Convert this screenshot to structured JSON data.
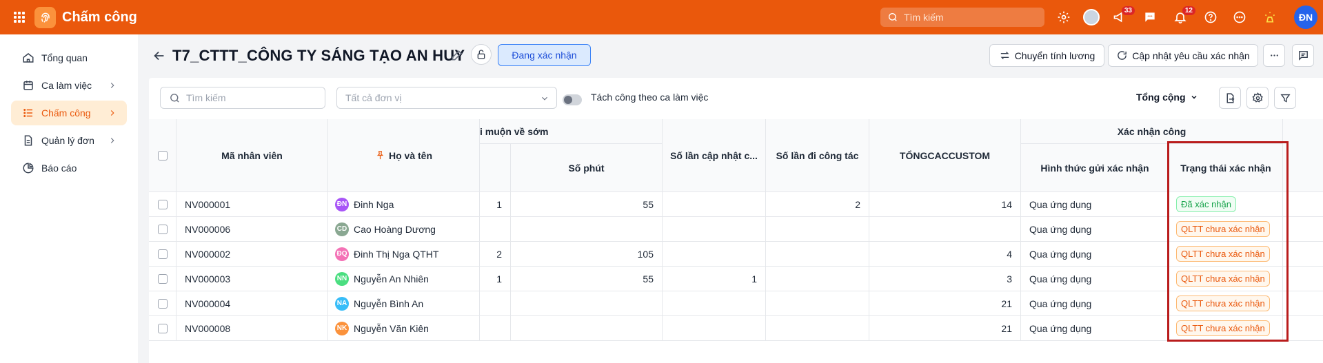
{
  "app": {
    "title": "Chấm công",
    "search_placeholder": "Tìm kiếm",
    "user_initials": "ĐN",
    "badges": {
      "announcements": "33",
      "notifications": "12"
    },
    "accent": "#ea580c"
  },
  "sidebar": {
    "items": [
      {
        "label": "Tổng quan",
        "icon": "home-icon"
      },
      {
        "label": "Ca làm việc",
        "icon": "calendar-icon"
      },
      {
        "label": "Chấm công",
        "icon": "list-icon",
        "active": true
      },
      {
        "label": "Quản lý đơn",
        "icon": "document-icon"
      },
      {
        "label": "Báo cáo",
        "icon": "pie-chart-icon"
      }
    ]
  },
  "header": {
    "title": "T7_CTTT_CÔNG TY SÁNG TẠO AN HUY",
    "status": "Đang xác nhận",
    "salary_button": "Chuyển tính lương",
    "update_button": "Cập nhật yêu cầu xác nhận"
  },
  "toolbar": {
    "search_placeholder": "Tìm kiếm",
    "unit_placeholder": "Tất cả đơn vị",
    "split_label": "Tách công theo ca làm việc",
    "total_label": "Tổng cộng"
  },
  "table": {
    "group_headers": {
      "late": "i muộn về sớm",
      "confirm": "Xác nhận công"
    },
    "columns": {
      "code": "Mã nhân viên",
      "name": "Họ và tên",
      "minutes": "Số phút",
      "updates": "Số lần cập nhật c...",
      "trips": "Số lần đi công tác",
      "custom": "TỔNGCACCUSTOM",
      "method": "Hình thức gửi xác nhận",
      "status": "Trạng thái xác nhận"
    },
    "rows": [
      {
        "code": "NV000001",
        "initials": "ĐN",
        "avatar_color": "#a855f7",
        "name": "Đinh Nga",
        "count": "1",
        "minutes": "55",
        "updates": "",
        "trips": "2",
        "custom": "14",
        "method": "Qua ứng dụng",
        "status": "Đã xác nhận",
        "status_type": "ok"
      },
      {
        "code": "NV000006",
        "initials": "CD",
        "avatar_color": "#8aa892",
        "name": "Cao Hoàng Dương",
        "count": "",
        "minutes": "",
        "updates": "",
        "trips": "",
        "custom": "",
        "method": "Qua ứng dụng",
        "status": "QLTT chưa xác nhận",
        "status_type": "warn"
      },
      {
        "code": "NV000002",
        "initials": "ĐQ",
        "avatar_color": "#f472b6",
        "name": "Đinh Thị Nga QTHT",
        "count": "2",
        "minutes": "105",
        "updates": "",
        "trips": "",
        "custom": "4",
        "method": "Qua ứng dụng",
        "status": "QLTT chưa xác nhận",
        "status_type": "warn"
      },
      {
        "code": "NV000003",
        "initials": "NN",
        "avatar_color": "#4ade80",
        "name": "Nguyễn An Nhiên",
        "count": "1",
        "minutes": "55",
        "updates": "1",
        "trips": "",
        "custom": "3",
        "method": "Qua ứng dụng",
        "status": "QLTT chưa xác nhận",
        "status_type": "warn"
      },
      {
        "code": "NV000004",
        "initials": "NA",
        "avatar_color": "#38bdf8",
        "name": "Nguyễn Bình An",
        "count": "",
        "minutes": "",
        "updates": "",
        "trips": "",
        "custom": "21",
        "method": "Qua ứng dụng",
        "status": "QLTT chưa xác nhận",
        "status_type": "warn"
      },
      {
        "code": "NV000008",
        "initials": "NK",
        "avatar_color": "#fb923c",
        "name": "Nguyễn Văn Kiên",
        "count": "",
        "minutes": "",
        "updates": "",
        "trips": "",
        "custom": "21",
        "method": "Qua ứng dụng",
        "status": "QLTT chưa xác nhận",
        "status_type": "warn"
      }
    ]
  }
}
